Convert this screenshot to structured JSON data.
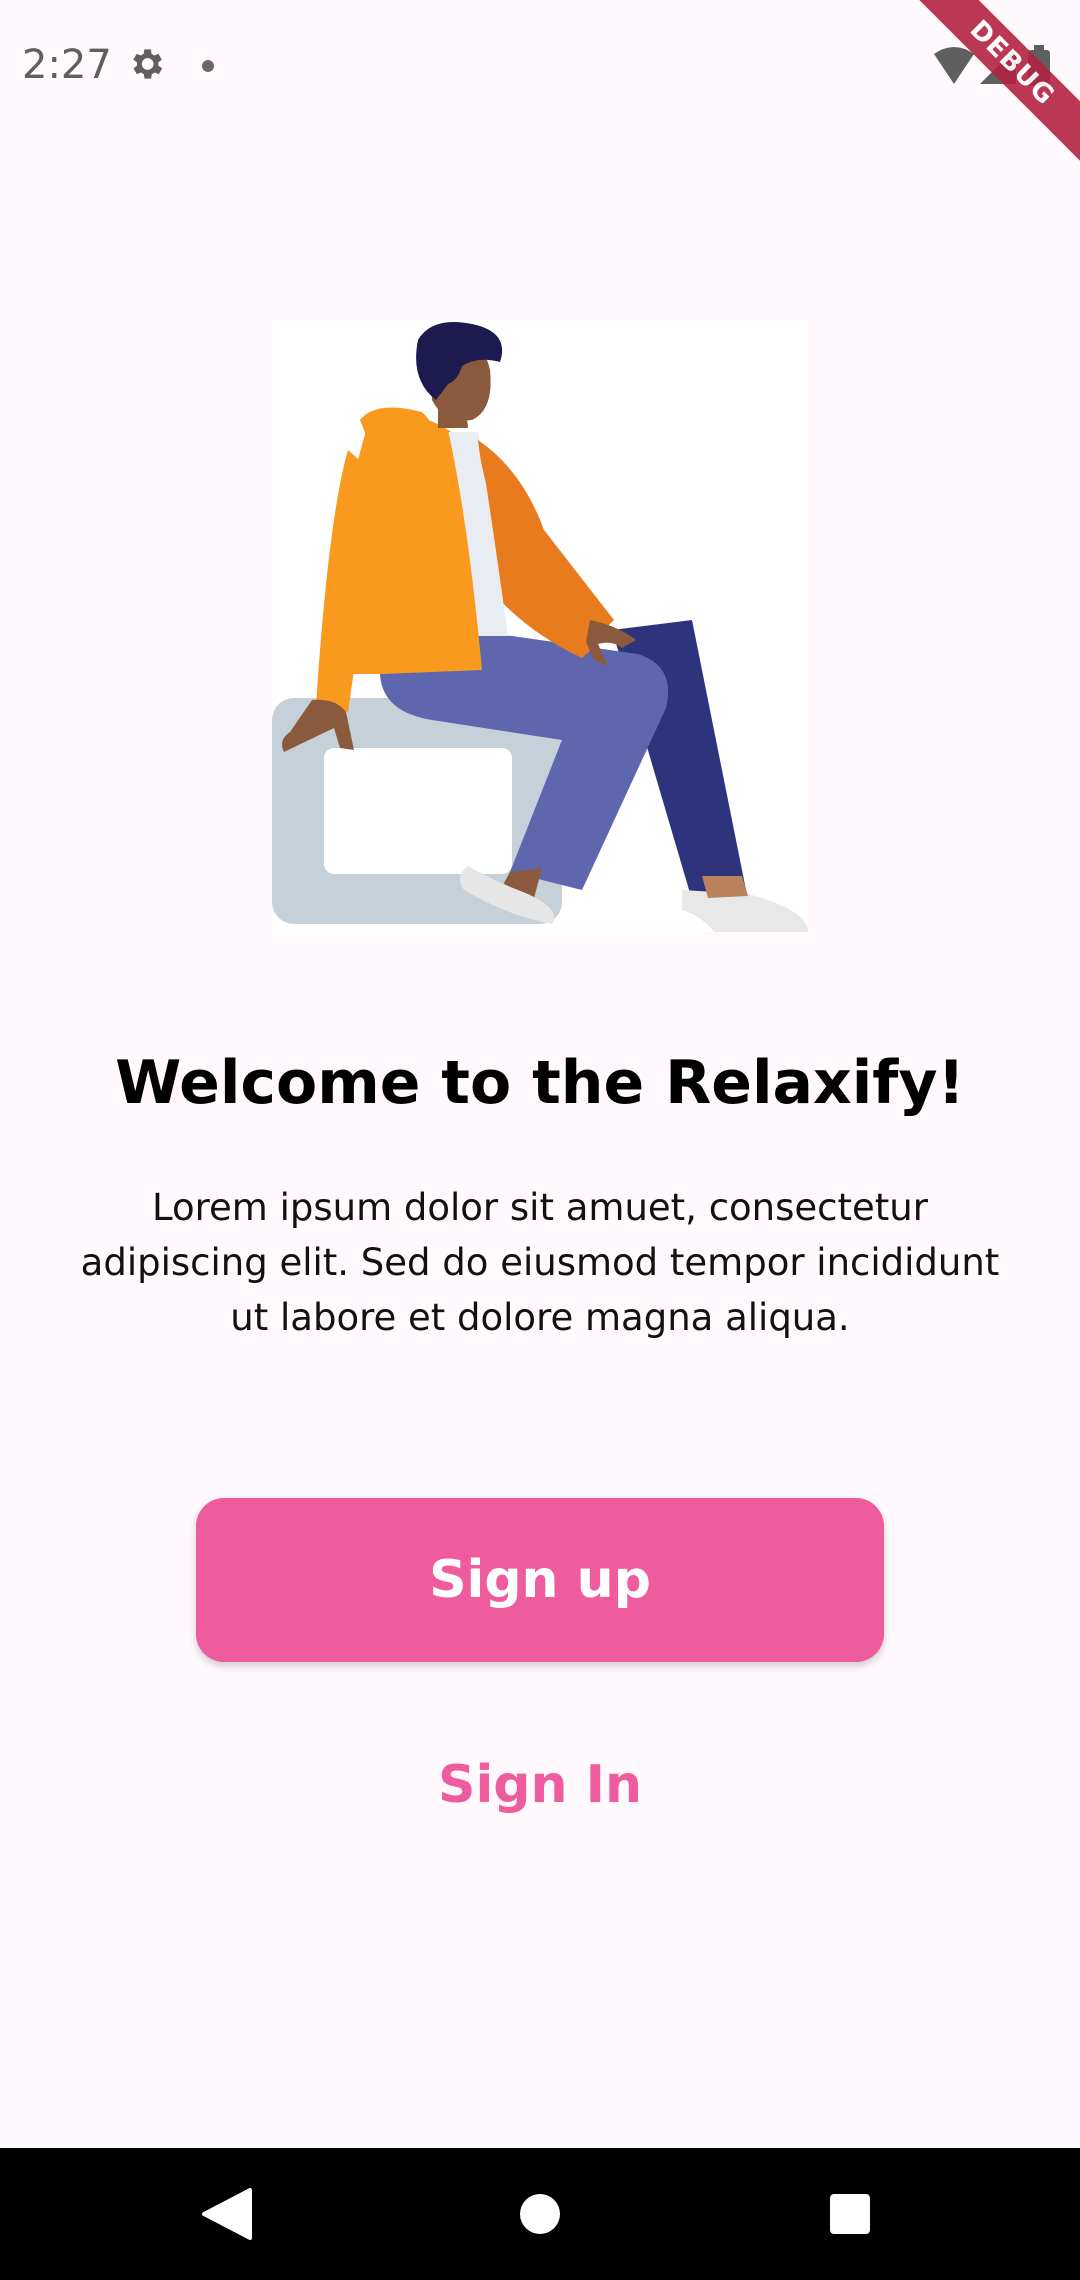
{
  "status_bar": {
    "time": "2:27",
    "icons": [
      "gear-icon",
      "notification-dot-icon",
      "wifi-icon",
      "signal-icon",
      "battery-icon"
    ]
  },
  "debug_banner": {
    "label": "DEBUG"
  },
  "onboarding": {
    "illustration": "person-sitting-illustration",
    "title": "Welcome to the Relaxify!",
    "description": "Lorem ipsum dolor sit amuet, consectetur adipiscing elit. Sed do eiusmod tempor incididunt ut labore et dolore magna aliqua."
  },
  "actions": {
    "signup_label": "Sign up",
    "signin_label": "Sign In"
  },
  "colors": {
    "accent": "#EE5C9E",
    "background": "#FFF8FC"
  },
  "nav_bar": {
    "buttons": [
      "back-icon",
      "home-icon",
      "recents-icon"
    ]
  }
}
